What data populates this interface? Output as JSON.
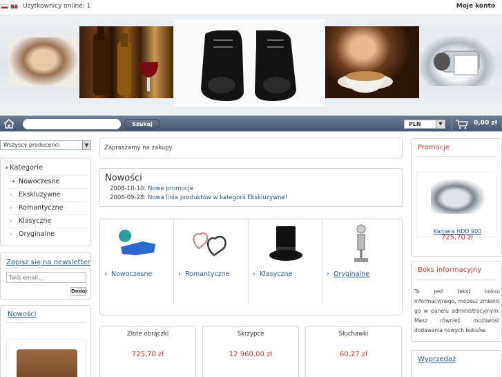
{
  "topbar": {
    "users_online": "Użytkownicy online: 1",
    "my_account": "Moje konto"
  },
  "navbar": {
    "search_placeholder": "",
    "search_button": "Szukaj",
    "currency": "PLN",
    "cart_total": "0,00 zł"
  },
  "sidebar_left": {
    "manufacturers_select": "Wszyscy producenci",
    "categories_title": "Kategorie",
    "categories": [
      "Nowoczesne",
      "Ekskluzywne",
      "Romantyczne",
      "Klasyczne",
      "Oryginalne"
    ],
    "newsletter_title": "Zapisz się na newsletter",
    "email_placeholder": "Twój email...",
    "join_button": "Dodaj",
    "news_title": "Nowości"
  },
  "main": {
    "welcome": "Zapraszamy na zakupy.",
    "news_title": "Nowości",
    "news": [
      {
        "date": "2008-10-10:",
        "text": "Nowe promocje"
      },
      {
        "date": "2008-09-28:",
        "text": "Nowa linia produktów w kategorii Ekskluzywne!"
      }
    ],
    "category_tiles": [
      "Nowoczesne",
      "Romantyczne",
      "Klasyczne",
      "Oryginalne"
    ],
    "products": [
      {
        "name": "Złote obrączki",
        "price": "725,70 zł"
      },
      {
        "name": "Skrzypce",
        "price": "12 960,00 zł"
      },
      {
        "name": "Słuchawki",
        "price": "60,27 zł"
      }
    ]
  },
  "sidebar_right": {
    "promo_title": "Promocje",
    "promo_product": "Kamera HDD 900",
    "promo_price": "725,70 zł",
    "info_title": "Boks informacyjny",
    "info_text": "To jest tekst boksu informacyjnego, możesz zmienić go w panelu administracyjnym. Masz również możliwość dodawania nowych boksów.",
    "sale_title": "Wyprzedaż"
  },
  "colors": {
    "nav_bar": "#56637b",
    "link": "#2b5a9a",
    "price": "#c0392b"
  }
}
